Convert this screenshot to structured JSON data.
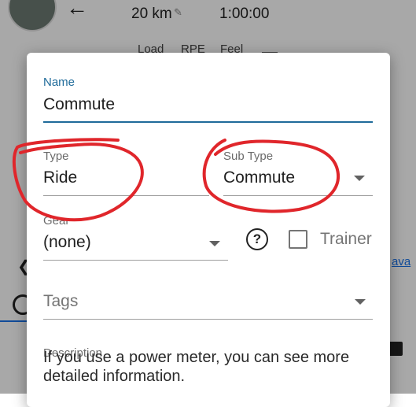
{
  "background": {
    "distance": "20 km",
    "duration": "1:00:00",
    "columns": [
      "Load",
      "RPE",
      "Feel"
    ],
    "side_link": "ava"
  },
  "dialog": {
    "name": {
      "label": "Name",
      "value": "Commute"
    },
    "type": {
      "label": "Type",
      "value": "Ride"
    },
    "subtype": {
      "label": "Sub Type",
      "value": "Commute"
    },
    "gear": {
      "label": "Gear",
      "value": "(none)"
    },
    "help_symbol": "?",
    "trainer": {
      "label": "Trainer",
      "checked": false
    },
    "tags": {
      "placeholder": "Tags"
    },
    "description": {
      "label": "Description",
      "text": "If you use a power meter, you can see more detailed information."
    }
  },
  "colors": {
    "accent": "#1f6b9a",
    "annotation": "#e0262b",
    "overlay": "rgba(0,0,0,0.34)"
  },
  "icons": [
    "back-arrow-icon",
    "pencil-icon",
    "help-icon",
    "dropdown-caret-icon",
    "checkbox-icon",
    "chevron-left-icon"
  ]
}
